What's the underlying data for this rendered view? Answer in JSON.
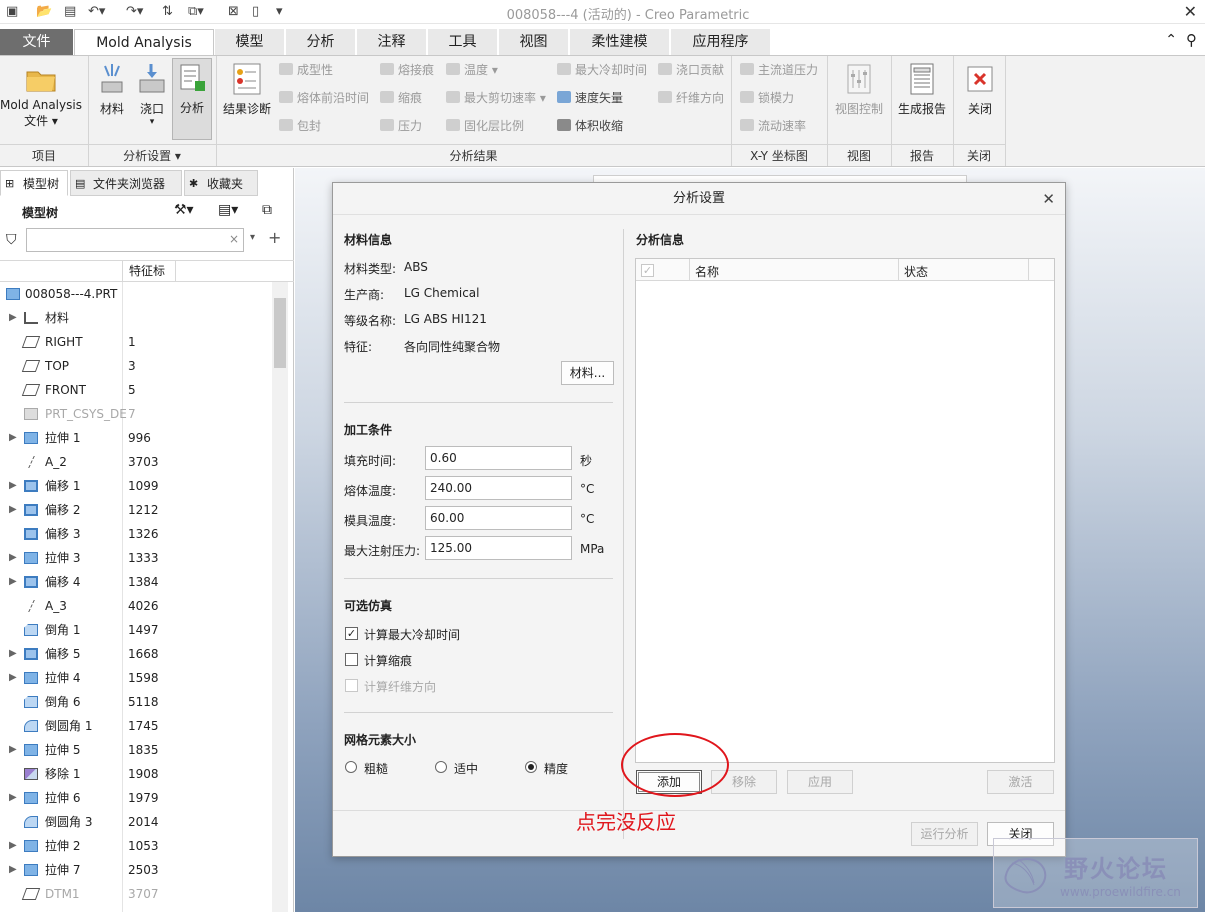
{
  "window": {
    "title": "008058---4 (活动的) - Creo Parametric"
  },
  "tabs": [
    "文件",
    "Mold Analysis",
    "模型",
    "分析",
    "注释",
    "工具",
    "视图",
    "柔性建模",
    "应用程序"
  ],
  "ribbon": {
    "file_btn": "Mold Analysis",
    "file_btn2": "文件",
    "material_btn": "材料",
    "gate_btn": "浇口",
    "analysis_btn": "分析",
    "result_diag_btn": "结果诊断",
    "small_results": [
      "成型性",
      "熔体前沿时间",
      "包封",
      "熔接痕",
      "缩痕",
      "压力",
      "温度",
      "最大剪切速率",
      "固化层比例",
      "最大冷却时间",
      "速度矢量",
      "体积收缩",
      "浇口贡献",
      "纤维方向"
    ],
    "xy_items": [
      "主流道压力",
      "锁模力",
      "流动速率"
    ],
    "view_ctrl_btn": "视图控制",
    "report_btn": "生成报告",
    "close_btn": "关闭",
    "groups": [
      "项目",
      "分析设置",
      "分析结果",
      "X-Y 坐标图",
      "视图",
      "报告",
      "关闭"
    ]
  },
  "left_panel": {
    "tabs": [
      "模型树",
      "文件夹浏览器",
      "收藏夹"
    ],
    "tree_header": "模型树",
    "column_feature_id": "特征标",
    "root": "008058---4.PRT",
    "rows": [
      {
        "name": "材料",
        "id": "",
        "expand": true,
        "icon": "material"
      },
      {
        "name": "RIGHT",
        "id": "1",
        "expand": false,
        "icon": "plane"
      },
      {
        "name": "TOP",
        "id": "3",
        "expand": false,
        "icon": "plane"
      },
      {
        "name": "FRONT",
        "id": "5",
        "expand": false,
        "icon": "plane"
      },
      {
        "name": "PRT_CSYS_DE",
        "id": "7",
        "expand": false,
        "icon": "csys",
        "dim": true
      },
      {
        "name": "拉伸 1",
        "id": "996",
        "expand": true,
        "icon": "extrude"
      },
      {
        "name": "A_2",
        "id": "3703",
        "expand": false,
        "icon": "axis"
      },
      {
        "name": "偏移 1",
        "id": "1099",
        "expand": true,
        "icon": "offset"
      },
      {
        "name": "偏移 2",
        "id": "1212",
        "expand": true,
        "icon": "offset"
      },
      {
        "name": "偏移 3",
        "id": "1326",
        "expand": false,
        "icon": "offset"
      },
      {
        "name": "拉伸 3",
        "id": "1333",
        "expand": true,
        "icon": "extrude"
      },
      {
        "name": "偏移 4",
        "id": "1384",
        "expand": true,
        "icon": "offset"
      },
      {
        "name": "A_3",
        "id": "4026",
        "expand": false,
        "icon": "axis"
      },
      {
        "name": "倒角 1",
        "id": "1497",
        "expand": false,
        "icon": "chamfer"
      },
      {
        "name": "偏移 5",
        "id": "1668",
        "expand": true,
        "icon": "offset"
      },
      {
        "name": "拉伸 4",
        "id": "1598",
        "expand": true,
        "icon": "extrude"
      },
      {
        "name": "倒角 6",
        "id": "5118",
        "expand": false,
        "icon": "chamfer"
      },
      {
        "name": "倒圆角 1",
        "id": "1745",
        "expand": false,
        "icon": "round"
      },
      {
        "name": "拉伸 5",
        "id": "1835",
        "expand": true,
        "icon": "extrude"
      },
      {
        "name": "移除 1",
        "id": "1908",
        "expand": false,
        "icon": "remove"
      },
      {
        "name": "拉伸 6",
        "id": "1979",
        "expand": true,
        "icon": "extrude"
      },
      {
        "name": "倒圆角 3",
        "id": "2014",
        "expand": false,
        "icon": "round"
      },
      {
        "name": "拉伸 2",
        "id": "1053",
        "expand": true,
        "icon": "extrude"
      },
      {
        "name": "拉伸 7",
        "id": "2503",
        "expand": true,
        "icon": "extrude"
      },
      {
        "name": "DTM1",
        "id": "3707",
        "expand": false,
        "icon": "plane",
        "dim": true
      }
    ]
  },
  "dialog": {
    "title": "分析设置",
    "material_section": "材料信息",
    "material_type_label": "材料类型:",
    "material_type": "ABS",
    "manufacturer_label": "生产商:",
    "manufacturer": "LG Chemical",
    "grade_label": "等级名称:",
    "grade": "LG ABS HI121",
    "property_label": "特征:",
    "property": "各向同性纯聚合物",
    "material_button": "材料...",
    "process_section": "加工条件",
    "fill_time_label": "填充时间:",
    "fill_time": "0.60",
    "fill_time_unit": "秒",
    "melt_temp_label": "熔体温度:",
    "melt_temp": "240.00",
    "melt_temp_unit": "°C",
    "mold_temp_label": "模具温度:",
    "mold_temp": "60.00",
    "mold_temp_unit": "°C",
    "max_pressure_label": "最大注射压力:",
    "max_pressure": "125.00",
    "max_pressure_unit": "MPa",
    "optional_section": "可选仿真",
    "opt_cooling": "计算最大冷却时间",
    "opt_sink": "计算缩痕",
    "opt_fiber": "计算纤维方向",
    "mesh_section": "网格元素大小",
    "mesh_coarse": "粗糙",
    "mesh_medium": "适中",
    "mesh_fine": "精度",
    "analysis_info_section": "分析信息",
    "col_name": "名称",
    "col_status": "状态",
    "add_btn": "添加",
    "remove_btn": "移除",
    "apply_btn": "应用",
    "activate_btn": "激活",
    "run_btn": "运行分析",
    "close_btn": "关闭"
  },
  "annotation": {
    "text": "点完没反应",
    "color": "#e0161c"
  },
  "watermark": {
    "title": "野火论坛",
    "url": "www.proewildfire.cn"
  }
}
